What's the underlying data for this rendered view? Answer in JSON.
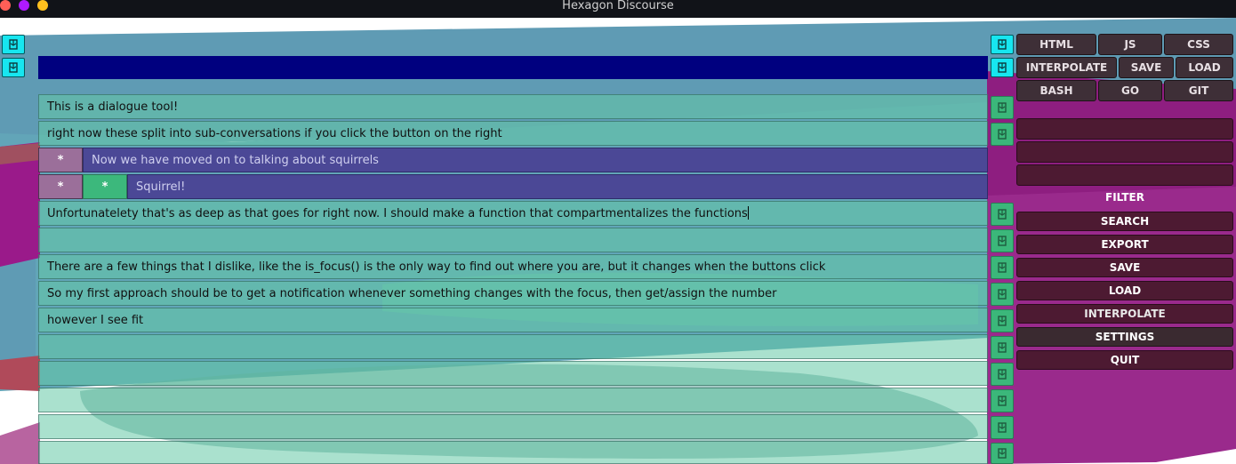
{
  "window": {
    "title": "Hexagon Discourse",
    "controls": [
      {
        "name": "close",
        "color": "#ff5f57"
      },
      {
        "name": "minimize",
        "color": "#b01aff"
      },
      {
        "name": "maximize",
        "color": "#ffc01e"
      }
    ]
  },
  "colors": {
    "accent_cyan": "#17e6f0",
    "top_bar": "#00007f",
    "row_green": "#64c8a5",
    "subconversation": "#4b4896",
    "panel_button": "#3e2f37",
    "panel_field": "#4d1a32"
  },
  "rows": [
    {
      "text": "This is a dialogue tool!"
    },
    {
      "text": "right now these split into sub-conversations if you click the button on the right"
    },
    {
      "text": "Unfortunatelety that's as deep as that goes for right now. I should make a function that compartmentalizes the functions"
    },
    {
      "text": ""
    },
    {
      "text": "There are a few things that I dislike, like the is_focus() is the only way to find out where you are, but it changes when the buttons click"
    },
    {
      "text": "So my first approach should be to get a notification whenever something changes with the focus, then get/assign the number"
    },
    {
      "text": "however I see fit"
    },
    {
      "text": ""
    },
    {
      "text": ""
    },
    {
      "text": ""
    },
    {
      "text": ""
    },
    {
      "text": ""
    }
  ],
  "subconversations": [
    {
      "marker": "*",
      "text": "Now we have moved on to talking about squirrels"
    },
    {
      "marker": "*",
      "marker2": "*",
      "text": "Squirrel!"
    }
  ],
  "toolbar": {
    "row1": [
      "HTML",
      "JS",
      "CSS"
    ],
    "row2": [
      "INTERPOLATE",
      "SAVE",
      "LOAD"
    ],
    "row3": [
      "BASH",
      "GO",
      "GIT"
    ]
  },
  "menu": {
    "filter": "FILTER",
    "search": "SEARCH",
    "export": "EXPORT",
    "save": "SAVE",
    "load": "LOAD",
    "interpolate": "INTERPOLATE",
    "settings": "SETTINGS",
    "quit": "QUIT"
  },
  "icons": {
    "split": "split-icon"
  }
}
